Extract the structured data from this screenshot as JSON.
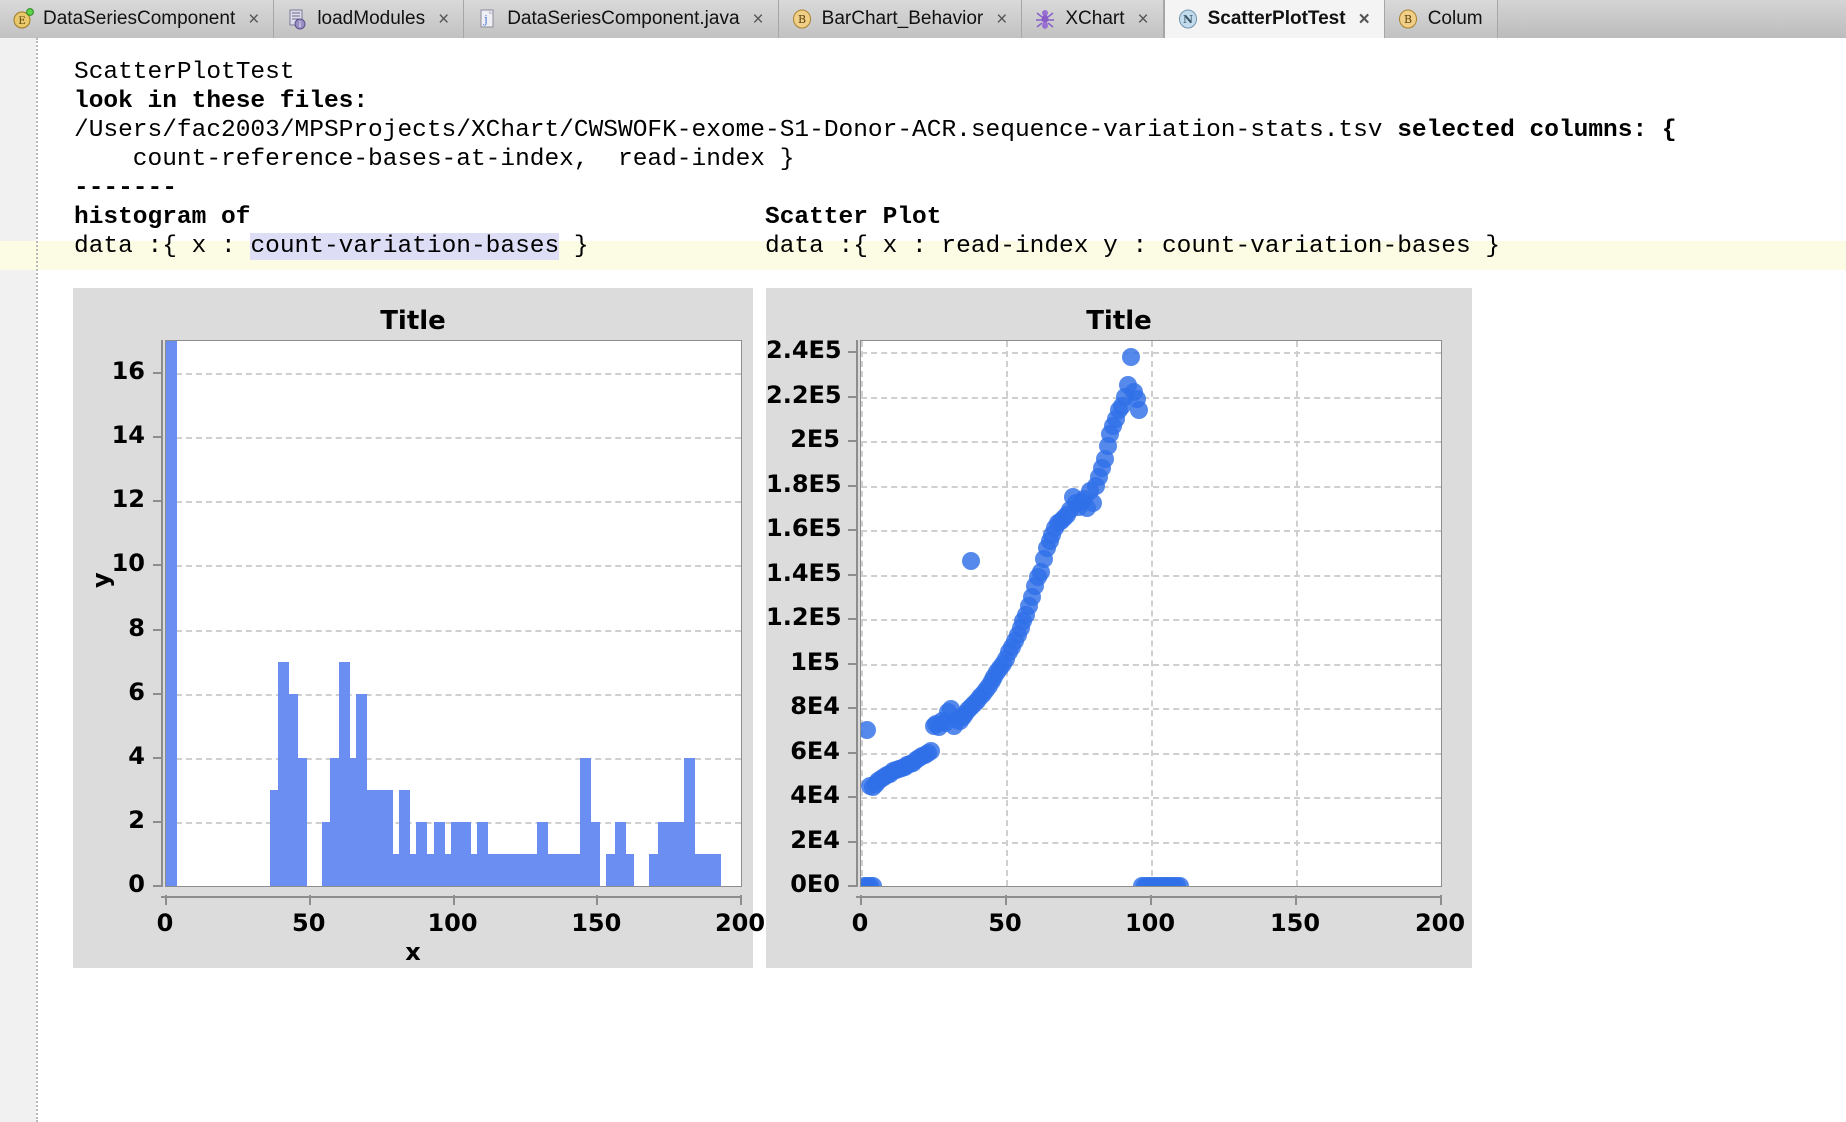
{
  "tabs": [
    {
      "label": "DataSeriesComponent",
      "icon": "eclipse-project-icon",
      "active": false,
      "close": "×"
    },
    {
      "label": "loadModules",
      "icon": "module-list-icon",
      "active": false,
      "close": "×"
    },
    {
      "label": "DataSeriesComponent.java",
      "icon": "java-file-icon",
      "active": false,
      "close": "×"
    },
    {
      "label": "BarChart_Behavior",
      "icon": "behavior-b-icon",
      "active": false,
      "close": "×"
    },
    {
      "label": "XChart",
      "icon": "ant-bug-icon",
      "active": false,
      "close": "×"
    },
    {
      "label": "ScatterPlotTest",
      "icon": "node-n-icon",
      "active": true,
      "close": "×"
    },
    {
      "label": "Colum",
      "icon": "behavior-b-icon",
      "active": false,
      "close": "×"
    }
  ],
  "code": {
    "line1": "ScatterPlotTest",
    "line2": "look in these files:",
    "line3_path": "/Users/fac2003/MPSProjects/XChart/CWSWOFK-exome-S1-Donor-ACR.sequence-variation-stats.tsv ",
    "line3_bold": "selected columns: {",
    "line4": "    count-reference-bases-at-index,  read-index }",
    "line5": "-------",
    "hist_header": "histogram of",
    "scatter_header": "Scatter Plot",
    "hist_data_prefix": "data :{ x : ",
    "hist_data_selected": "count-variation-bases",
    "hist_data_suffix": " }",
    "scatter_data": "data :{ x : read-index y : count-variation-bases }"
  },
  "charts": {
    "histogram": {
      "title": "Title",
      "xlabel": "x",
      "ylabel": "y"
    },
    "scatter": {
      "title": "Title",
      "xlabel": "",
      "ylabel": ""
    }
  },
  "chart_data": [
    {
      "type": "bar",
      "title": "Title",
      "xlabel": "x",
      "ylabel": "y",
      "xlim": [
        0,
        200
      ],
      "ylim": [
        0,
        17
      ],
      "xticks": [
        0,
        50,
        100,
        150,
        200
      ],
      "yticks": [
        0,
        2,
        4,
        6,
        8,
        10,
        12,
        14,
        16
      ],
      "grid": true,
      "bar_color": "#6b8ef2",
      "note": "histogram of count-variation-bases",
      "x": [
        2,
        38,
        41,
        44,
        47,
        56,
        59,
        62,
        65,
        68,
        71,
        74,
        77,
        80,
        83,
        86,
        89,
        92,
        95,
        98,
        101,
        104,
        107,
        110,
        113,
        116,
        119,
        122,
        125,
        128,
        131,
        134,
        137,
        140,
        143,
        146,
        149,
        155,
        158,
        161,
        170,
        173,
        176,
        179,
        182,
        185,
        188,
        191
      ],
      "values": [
        17,
        3,
        7,
        6,
        4,
        2,
        4,
        7,
        4,
        6,
        3,
        3,
        3,
        1,
        3,
        1,
        2,
        1,
        2,
        1,
        2,
        2,
        1,
        2,
        1,
        1,
        1,
        1,
        1,
        1,
        2,
        1,
        1,
        1,
        1,
        4,
        2,
        1,
        2,
        1,
        1,
        2,
        2,
        2,
        4,
        1,
        1,
        1
      ]
    },
    {
      "type": "scatter",
      "title": "Title",
      "xlabel": "",
      "ylabel": "",
      "xlim": [
        0,
        200
      ],
      "ylim": [
        0,
        245000
      ],
      "xticks": [
        0,
        50,
        100,
        150,
        200
      ],
      "yticks": [
        0,
        20000,
        40000,
        60000,
        80000,
        100000,
        120000,
        140000,
        160000,
        180000,
        200000,
        220000,
        240000
      ],
      "ytick_labels": [
        "0E0",
        "2E4",
        "4E4",
        "6E4",
        "8E4",
        "1E5",
        "1.2E5",
        "1.4E5",
        "1.6E5",
        "1.8E5",
        "2E5",
        "2.2E5",
        "2.4E5"
      ],
      "grid": true,
      "marker_color": "#2f6fe8",
      "note": "read-index vs count-variation-bases",
      "points": [
        [
          1,
          0
        ],
        [
          2,
          0
        ],
        [
          3,
          0
        ],
        [
          4,
          0
        ],
        [
          2,
          70000
        ],
        [
          3,
          45000
        ],
        [
          4,
          44500
        ],
        [
          5,
          46000
        ],
        [
          6,
          47000
        ],
        [
          7,
          48000
        ],
        [
          8,
          49000
        ],
        [
          9,
          50000
        ],
        [
          10,
          50500
        ],
        [
          11,
          51500
        ],
        [
          12,
          52000
        ],
        [
          13,
          52500
        ],
        [
          14,
          53000
        ],
        [
          15,
          53500
        ],
        [
          16,
          54500
        ],
        [
          17,
          55000
        ],
        [
          18,
          55500
        ],
        [
          19,
          56500
        ],
        [
          20,
          57500
        ],
        [
          21,
          58500
        ],
        [
          22,
          59000
        ],
        [
          23,
          60000
        ],
        [
          24,
          60500
        ],
        [
          25,
          72000
        ],
        [
          26,
          73000
        ],
        [
          27,
          71500
        ],
        [
          28,
          74000
        ],
        [
          29,
          73500
        ],
        [
          30,
          78000
        ],
        [
          31,
          79500
        ],
        [
          32,
          72000
        ],
        [
          33,
          74500
        ],
        [
          34,
          74000
        ],
        [
          35,
          76000
        ],
        [
          36,
          77500
        ],
        [
          37,
          79000
        ],
        [
          38,
          80500
        ],
        [
          38,
          146000
        ],
        [
          39,
          82000
        ],
        [
          40,
          83000
        ],
        [
          41,
          85000
        ],
        [
          42,
          86500
        ],
        [
          43,
          88000
        ],
        [
          44,
          90000
        ],
        [
          45,
          92000
        ],
        [
          46,
          94000
        ],
        [
          47,
          96000
        ],
        [
          48,
          98000
        ],
        [
          49,
          100000
        ],
        [
          50,
          102000
        ],
        [
          51,
          105000
        ],
        [
          52,
          107500
        ],
        [
          53,
          110000
        ],
        [
          54,
          113000
        ],
        [
          55,
          116000
        ],
        [
          56,
          119000
        ],
        [
          57,
          122000
        ],
        [
          58,
          126000
        ],
        [
          59,
          130000
        ],
        [
          60,
          135000
        ],
        [
          61,
          139000
        ],
        [
          62,
          141000
        ],
        [
          63,
          147000
        ],
        [
          64,
          152000
        ],
        [
          65,
          155000
        ],
        [
          66,
          158000
        ],
        [
          67,
          161000
        ],
        [
          68,
          163000
        ],
        [
          69,
          164000
        ],
        [
          70,
          165500
        ],
        [
          71,
          167000
        ],
        [
          72,
          169000
        ],
        [
          73,
          175000
        ],
        [
          74,
          172000
        ],
        [
          75,
          170500
        ],
        [
          76,
          172500
        ],
        [
          77,
          174000
        ],
        [
          78,
          170000
        ],
        [
          79,
          177500
        ],
        [
          80,
          172000
        ],
        [
          81,
          180000
        ],
        [
          82,
          184000
        ],
        [
          83,
          188000
        ],
        [
          84,
          192000
        ],
        [
          85,
          198000
        ],
        [
          86,
          203000
        ],
        [
          87,
          207000
        ],
        [
          88,
          210000
        ],
        [
          89,
          214000
        ],
        [
          90,
          216000
        ],
        [
          91,
          220000
        ],
        [
          92,
          225000
        ],
        [
          93,
          238000
        ],
        [
          94,
          222000
        ],
        [
          95,
          219000
        ],
        [
          96,
          214000
        ],
        [
          97,
          0
        ],
        [
          98,
          0
        ],
        [
          99,
          0
        ],
        [
          100,
          0
        ],
        [
          101,
          0
        ],
        [
          102,
          0
        ],
        [
          103,
          0
        ],
        [
          104,
          0
        ],
        [
          105,
          0
        ],
        [
          106,
          0
        ],
        [
          107,
          0
        ],
        [
          108,
          0
        ],
        [
          109,
          0
        ],
        [
          110,
          0
        ]
      ]
    }
  ]
}
